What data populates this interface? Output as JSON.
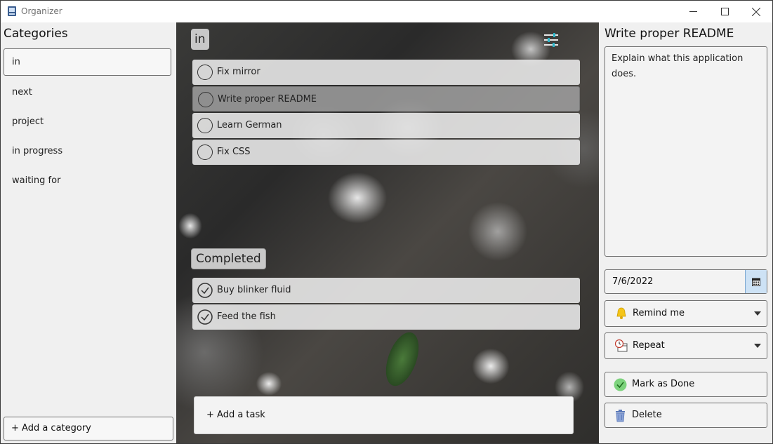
{
  "window": {
    "title": "Organizer"
  },
  "sidebar": {
    "heading": "Categories",
    "items": [
      {
        "label": "in",
        "selected": true
      },
      {
        "label": "next"
      },
      {
        "label": "project"
      },
      {
        "label": "in progress"
      },
      {
        "label": "waiting for"
      }
    ],
    "add_label": "+ Add a category"
  },
  "list": {
    "title": "in",
    "tasks": [
      {
        "label": "Fix mirror"
      },
      {
        "label": "Write proper README",
        "selected": true
      },
      {
        "label": "Learn German"
      },
      {
        "label": "Fix CSS"
      }
    ],
    "completed_title": "Completed",
    "completed": [
      {
        "label": "Buy blinker fluid"
      },
      {
        "label": "Feed the fish"
      }
    ],
    "add_label": "+ Add a task"
  },
  "detail": {
    "title": "Write proper README",
    "notes": "Explain what this application does.",
    "date": "7/6/2022",
    "remind_label": "Remind me",
    "repeat_label": "Repeat",
    "done_label": "Mark as Done",
    "delete_label": "Delete"
  },
  "colors": {
    "accent": "#cde2f5",
    "done_green": "#6cc36c",
    "bell_yellow": "#f5c518",
    "delete_blue": "#5a78b8"
  }
}
